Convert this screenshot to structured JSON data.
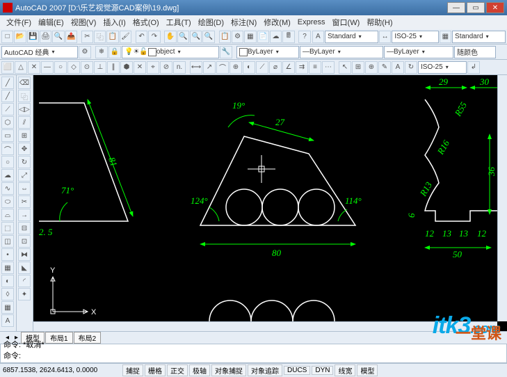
{
  "window": {
    "title": "AutoCAD 2007  [D:\\乐艺视觉源CAD案例\\19.dwg]"
  },
  "menu": {
    "items": [
      "文件(F)",
      "编辑(E)",
      "视图(V)",
      "插入(I)",
      "格式(O)",
      "工具(T)",
      "绘图(D)",
      "标注(N)",
      "修改(M)",
      "Express",
      "窗口(W)",
      "帮助(H)"
    ]
  },
  "toolbars": {
    "workspace": "AutoCAD 经典",
    "object_combo": "object",
    "layer_color": "#ffffff",
    "bylayer": "ByLayer",
    "linetype": "ByLayer",
    "text_style": "Standard",
    "dim_style_a": "ISO-25",
    "dim_style_b": "Standard",
    "dim_style_c": "ISO-25",
    "color_swatch": "随颜色"
  },
  "drawing": {
    "dims": {
      "left_angle": "71°",
      "left_81": "81",
      "left_2_5": "2. 5",
      "mid_19": "19°",
      "mid_27": "27",
      "mid_124": "124°",
      "mid_114": "114°",
      "mid_80": "80",
      "right_29": "29",
      "right_30": "30",
      "right_r55": "R55",
      "right_r16": "R16",
      "right_r13": "R13",
      "right_36": "36",
      "right_6": "6",
      "right_12a": "12",
      "right_13a": "13",
      "right_13b": "13",
      "right_12b": "12",
      "right_50": "50"
    },
    "ucs": {
      "x": "X",
      "y": "Y"
    }
  },
  "model_tabs": {
    "tab1": "模型",
    "tab2": "布局1",
    "tab3": "布局2"
  },
  "cmd": {
    "line1": "命令: *取消*",
    "line2": "命令:"
  },
  "status": {
    "coords": "6857.1538, 2624.6413, 0.0000",
    "panes": [
      "捕捉",
      "栅格",
      "正交",
      "极轴",
      "对象捕捉",
      "对象追踪",
      "DUCS",
      "DYN",
      "线宽",
      "模型"
    ]
  },
  "watermark1": "itk3",
  "watermark1_suffix": ".com",
  "watermark2": "一堂课"
}
